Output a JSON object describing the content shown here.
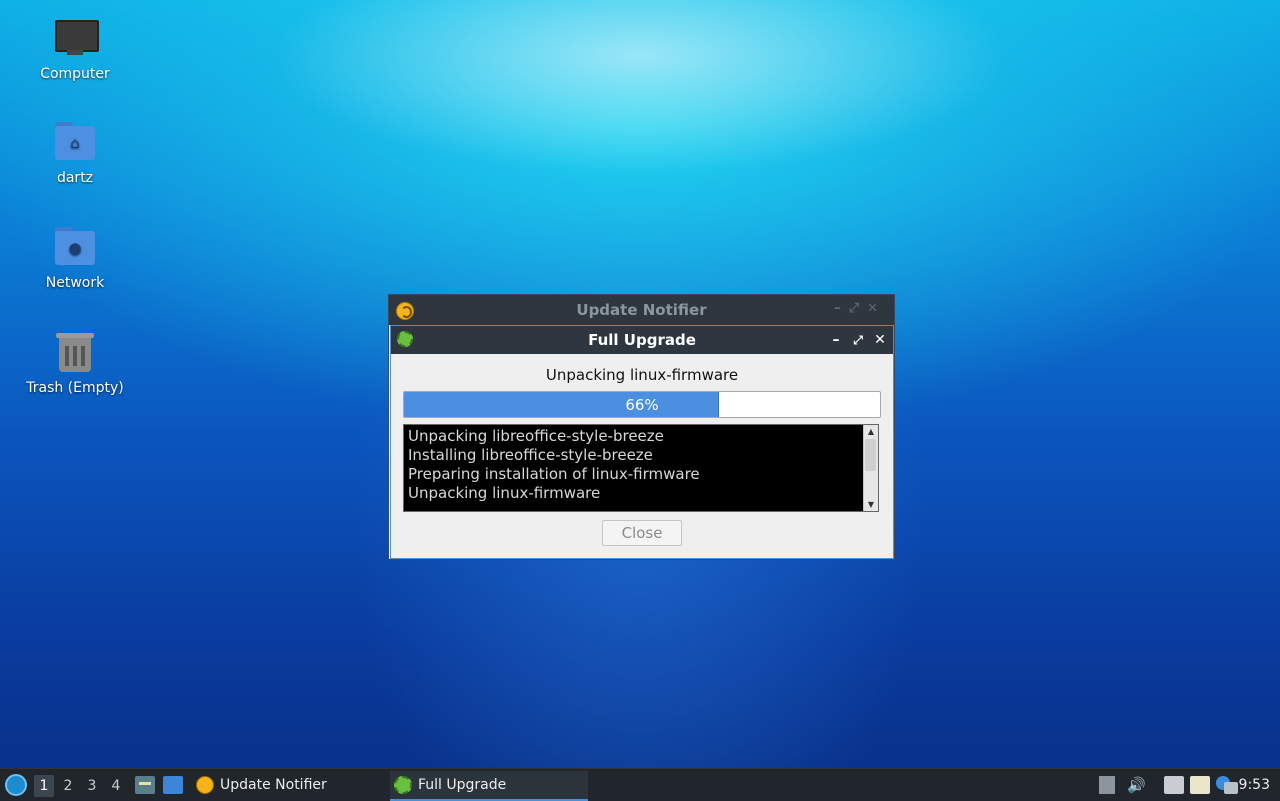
{
  "desktop": {
    "icons": [
      {
        "label": "Computer",
        "icon": "computer-icon"
      },
      {
        "label": "dartz",
        "icon": "home-folder-icon"
      },
      {
        "label": "Network",
        "icon": "network-folder-icon"
      },
      {
        "label": "Trash (Empty)",
        "icon": "trash-icon"
      }
    ]
  },
  "background_window": {
    "title": "Update Notifier"
  },
  "dialog": {
    "title": "Full Upgrade",
    "status": "Unpacking linux-firmware",
    "progress_percent": 66,
    "progress_label": "66%",
    "log": [
      "Unpacking libreoffice-style-breeze",
      "Installing libreoffice-style-breeze",
      "Preparing installation of linux-firmware",
      "Unpacking linux-firmware"
    ],
    "close_label": "Close",
    "colors": {
      "accent": "#4a8fe0",
      "titlebar": "#2e3640"
    }
  },
  "taskbar": {
    "workspaces": [
      "1",
      "2",
      "3",
      "4"
    ],
    "active_workspace": "1",
    "tasks": [
      {
        "label": "Update Notifier",
        "icon": "update-notifier-icon"
      },
      {
        "label": "Full Upgrade",
        "icon": "gear-icon"
      }
    ],
    "clock": "9:53"
  }
}
